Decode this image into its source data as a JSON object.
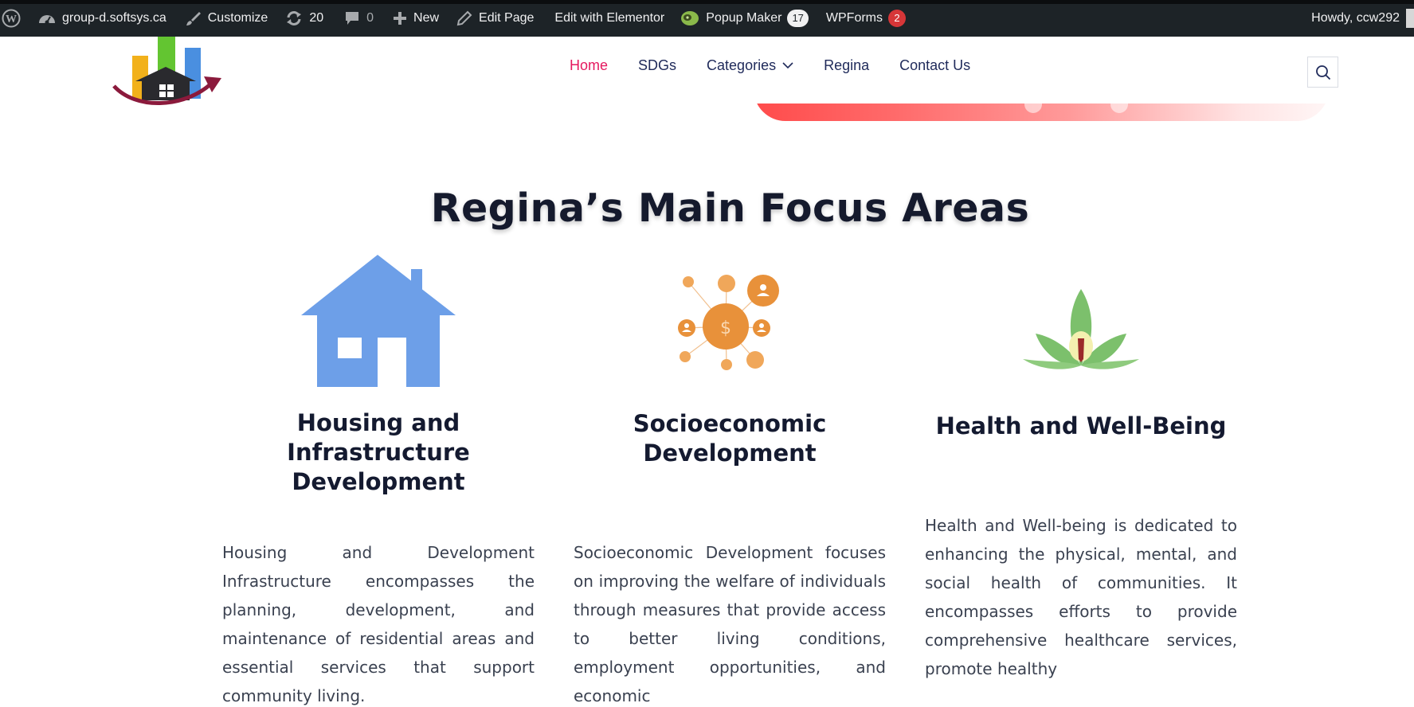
{
  "admin_bar": {
    "site_name": "group-d.softsys.ca",
    "customize": "Customize",
    "updates_count": "20",
    "comments_count": "0",
    "new_label": "New",
    "edit_page": "Edit Page",
    "edit_elementor": "Edit with Elementor",
    "popup_maker": "Popup Maker",
    "popup_maker_count": "17",
    "wpforms": "WPForms",
    "wpforms_count": "2",
    "howdy": "Howdy, ccw292"
  },
  "nav": {
    "items": [
      {
        "label": "Home",
        "active": true
      },
      {
        "label": "SDGs"
      },
      {
        "label": "Categories",
        "dropdown": true
      },
      {
        "label": "Regina"
      },
      {
        "label": "Contact Us"
      }
    ]
  },
  "section": {
    "title": "Regina’s Main Focus Areas",
    "columns": [
      {
        "icon": "house-icon",
        "title": "Housing and Infrastructure Development",
        "text": "Housing and Development Infrastructure encompasses the planning, development, and maintenance of residential areas and essential services that support community living."
      },
      {
        "icon": "network-money-icon",
        "title": "Socioeconomic Development",
        "text": "Socioeconomic Development focuses on improving the welfare of individuals through measures that provide access to better living conditions, employment opportunities, and economic"
      },
      {
        "icon": "leaf-icon",
        "title": "Health and Well-Being",
        "text": "Health and Well-being is dedicated to enhancing the physical, mental, and social health of communities. It encompasses efforts to provide comprehensive healthcare services, promote healthy"
      }
    ]
  },
  "colors": {
    "admin_bar_bg": "#1d2327",
    "nav_text": "#1f2a5a",
    "nav_active": "#e5195f",
    "house_blue": "#6d9fe8",
    "money_orange": "#e8913a",
    "leaf_green": "#7cc06c"
  }
}
